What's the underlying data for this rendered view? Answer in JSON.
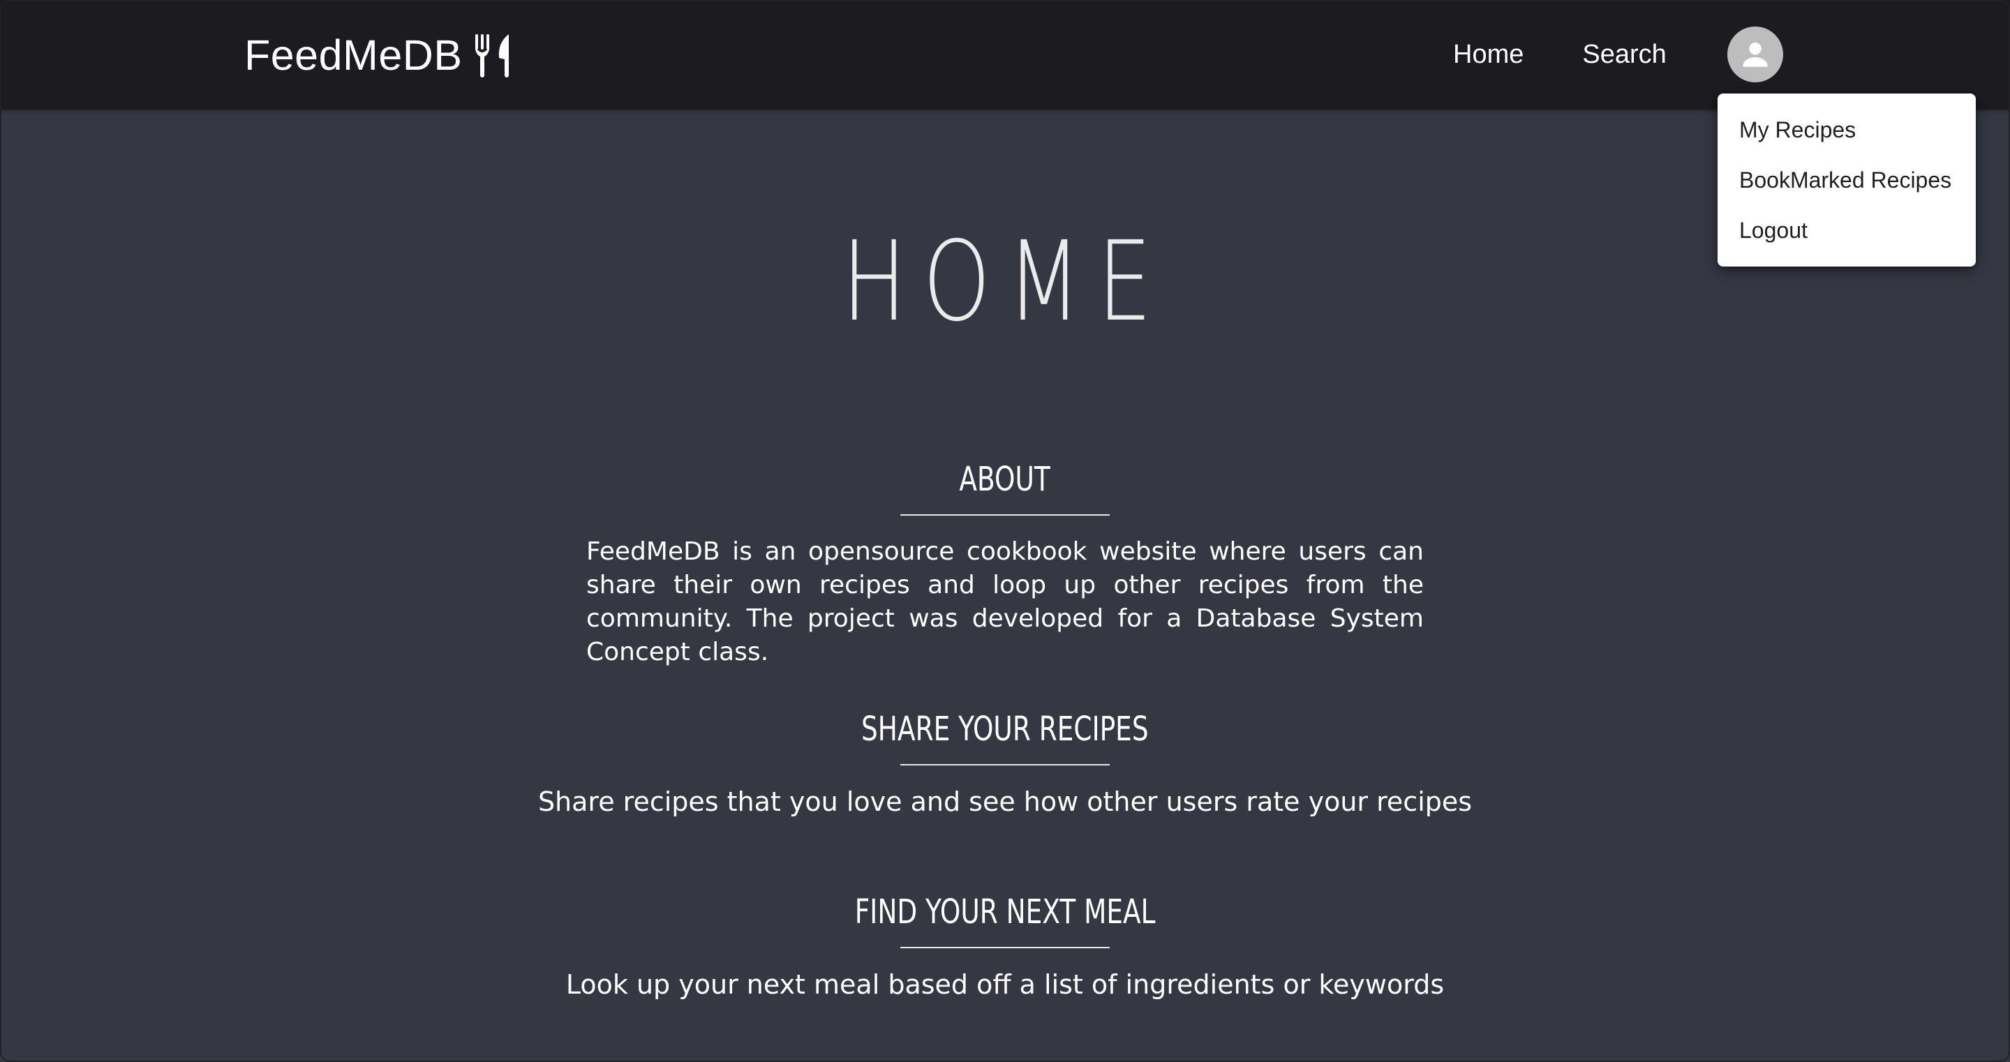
{
  "navbar": {
    "brand": "FeedMeDB",
    "brand_icon": "utensils-icon",
    "links": {
      "home": "Home",
      "search": "Search"
    },
    "avatar_icon": "person-icon"
  },
  "user_menu": {
    "items": [
      "My Recipes",
      "BookMarked Recipes",
      "Logout"
    ]
  },
  "page": {
    "title": "HOME",
    "sections": [
      {
        "heading": "ABOUT",
        "body": "FeedMeDB is an opensource cookbook website where users can share their own recipes and loop up other recipes from the community. The project was developed for a Database System Concept class."
      },
      {
        "heading": "SHARE YOUR RECIPES",
        "body": "Share recipes that you love and see how other users rate your recipes"
      },
      {
        "heading": "FIND YOUR NEXT MEAL",
        "body": "Look up your next meal based off a list of ingredients or keywords"
      }
    ]
  },
  "colors": {
    "navbar_bg": "#1b1b20",
    "page_bg": "#353843",
    "menu_bg": "#ffffff",
    "avatar_bg": "#bdbdbd"
  }
}
